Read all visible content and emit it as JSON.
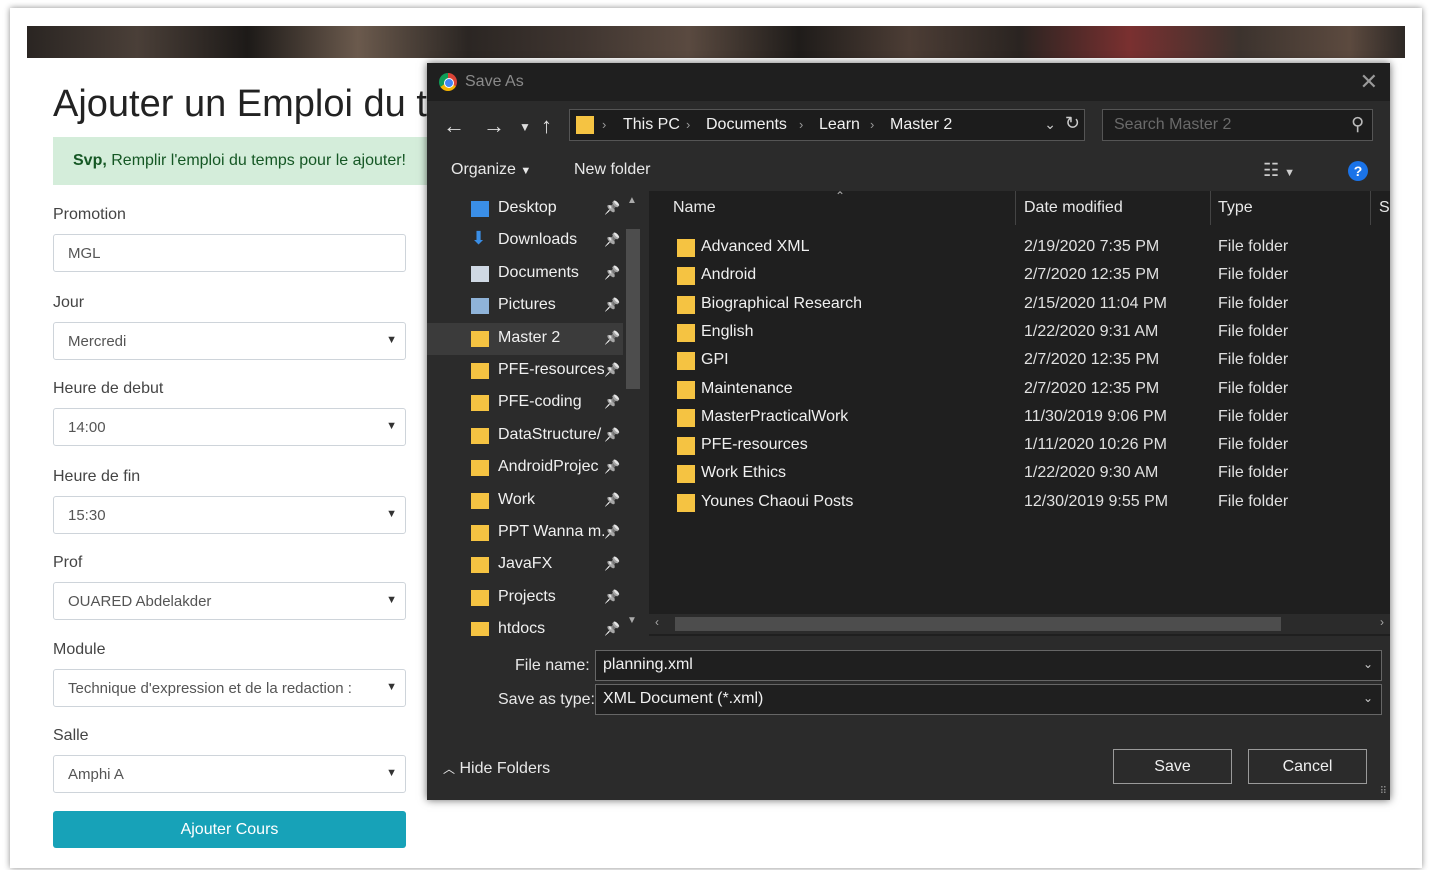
{
  "form": {
    "title": "Ajouter un Emploi du temps",
    "alert_strong": "Svp,",
    "alert_text": " Remplir l'emploi du temps pour le ajouter!",
    "fields": [
      {
        "label": "Promotion",
        "value": "MGL",
        "type": "text"
      },
      {
        "label": "Jour",
        "value": "Mercredi",
        "type": "select"
      },
      {
        "label": "Heure de debut",
        "value": "14:00",
        "type": "select"
      },
      {
        "label": "Heure de fin",
        "value": "15:30",
        "type": "select"
      },
      {
        "label": "Prof",
        "value": "OUARED Abdelakder",
        "type": "select"
      },
      {
        "label": "Module",
        "value": "Technique d'expression et de la redaction :",
        "type": "select"
      },
      {
        "label": "Salle",
        "value": "Amphi A",
        "type": "select"
      }
    ],
    "submit_label": "Ajouter Cours"
  },
  "dialog": {
    "title": "Save As",
    "breadcrumb": [
      "This PC",
      "Documents",
      "Learn",
      "Master 2"
    ],
    "search_placeholder": "Search Master 2",
    "organize_label": "Organize",
    "new_folder_label": "New folder",
    "nav_items": [
      {
        "label": "Desktop",
        "icon": "desktop-icon"
      },
      {
        "label": "Downloads",
        "icon": "download-icon"
      },
      {
        "label": "Documents",
        "icon": "documents-icon"
      },
      {
        "label": "Pictures",
        "icon": "pictures-icon"
      },
      {
        "label": "Master 2",
        "icon": "folder-icon",
        "selected": true
      },
      {
        "label": "PFE-resources",
        "icon": "folder-icon"
      },
      {
        "label": "PFE-coding",
        "icon": "folder-icon"
      },
      {
        "label": "DataStructure/",
        "icon": "folder-icon"
      },
      {
        "label": "AndroidProjec",
        "icon": "folder-icon"
      },
      {
        "label": "Work",
        "icon": "folder-icon"
      },
      {
        "label": "PPT Wanna m.",
        "icon": "folder-icon"
      },
      {
        "label": "JavaFX",
        "icon": "folder-icon"
      },
      {
        "label": "Projects",
        "icon": "folder-icon"
      },
      {
        "label": "htdocs",
        "icon": "folder-icon"
      }
    ],
    "columns": {
      "name": "Name",
      "date": "Date modified",
      "type": "Type",
      "size": "S"
    },
    "files": [
      {
        "name": "Advanced XML",
        "date": "2/19/2020 7:35 PM",
        "type": "File folder"
      },
      {
        "name": "Android",
        "date": "2/7/2020 12:35 PM",
        "type": "File folder"
      },
      {
        "name": "Biographical Research",
        "date": "2/15/2020 11:04 PM",
        "type": "File folder"
      },
      {
        "name": "English",
        "date": "1/22/2020 9:31 AM",
        "type": "File folder"
      },
      {
        "name": "GPI",
        "date": "2/7/2020 12:35 PM",
        "type": "File folder"
      },
      {
        "name": "Maintenance",
        "date": "2/7/2020 12:35 PM",
        "type": "File folder"
      },
      {
        "name": "MasterPracticalWork",
        "date": "11/30/2019 9:06 PM",
        "type": "File folder"
      },
      {
        "name": "PFE-resources",
        "date": "1/11/2020 10:26 PM",
        "type": "File folder"
      },
      {
        "name": "Work Ethics",
        "date": "1/22/2020 9:30 AM",
        "type": "File folder"
      },
      {
        "name": "Younes Chaoui Posts",
        "date": "12/30/2019 9:55 PM",
        "type": "File folder"
      }
    ],
    "file_name_label": "File name:",
    "file_name_value": "planning.xml",
    "save_type_label": "Save as type:",
    "save_type_value": "XML Document (*.xml)",
    "hide_folders_label": "Hide Folders",
    "save_label": "Save",
    "cancel_label": "Cancel"
  },
  "colors": {
    "accent_button": "#17a2b8",
    "alert_bg": "#d4edda",
    "dialog_bg": "#2b2b2b",
    "folder": "#f5c342"
  }
}
